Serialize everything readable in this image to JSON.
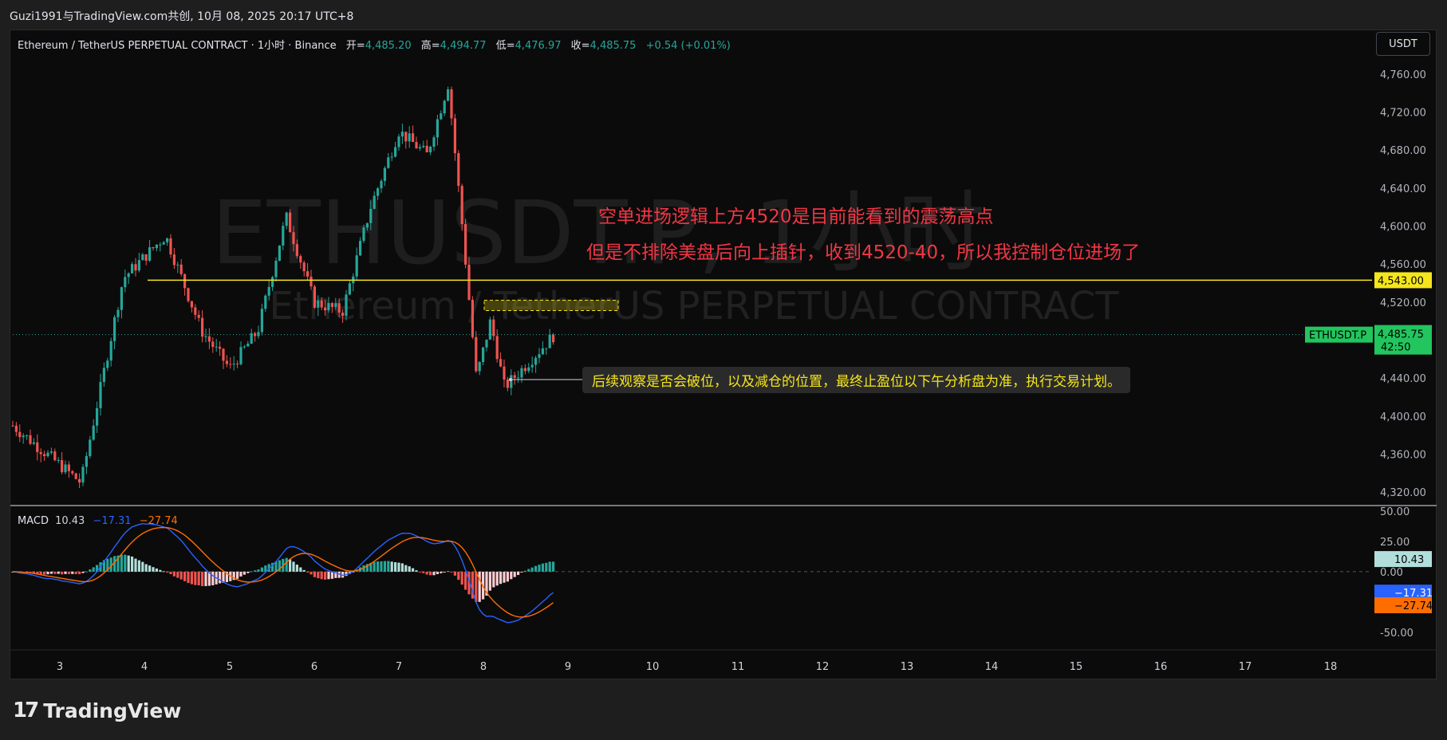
{
  "top_bar": "Guzi1991与TradingView.com共创, 10月 08, 2025 20:17 UTC+8",
  "header": {
    "symbol": "Ethereum / TetherUS PERPETUAL CONTRACT · 1小时 · Binance",
    "open_label": "开=",
    "open": "4,485.20",
    "high_label": "高=",
    "high": "4,494.77",
    "low_label": "低=",
    "low": "4,476.97",
    "close_label": "收=",
    "close": "4,485.75",
    "change": "+0.54 (+0.01%)"
  },
  "currency_button": "USDT",
  "watermark": {
    "line1": "ETHUSDT.P, 1小时",
    "line2": "Ethereum / TetherUS PERPETUAL CONTRACT"
  },
  "annotations": {
    "red_line1": "空单进场逻辑上方4520是目前能看到的震荡高点",
    "red_line2": "但是不排除美盘后向上插针，收到4520-40，所以我控制仓位进场了",
    "callout": "后续观察是否会破位，以及减仓的位置，最终止盈位以下午分析盘为准，执行交易计划。"
  },
  "price_labels": {
    "hline_price": "4,543.00",
    "symbol_tag": "ETHUSDT.P",
    "last_price": "4,485.75",
    "countdown": "42:50"
  },
  "macd_legend": {
    "name": "MACD",
    "hist": "10.43",
    "macd": "−17.31",
    "signal": "−27.74"
  },
  "macd_labels": {
    "hist": "10.43",
    "macd": "−17.31",
    "signal": "−27.74"
  },
  "logo_text": "TradingView",
  "colors": {
    "up": "#26a69a",
    "down": "#ef5350",
    "hline": "#f5e61c",
    "macd": "#2962ff",
    "signal": "#ff6d00",
    "note": "#f23645"
  },
  "chart_data": {
    "type": "candlestick",
    "title": "ETHUSDT.P, 1小时",
    "y_axis_ticks": [
      "4,760.00",
      "4,720.00",
      "4,680.00",
      "4,640.00",
      "4,600.00",
      "4,560.00",
      "4,520.00",
      "4,440.00",
      "4,400.00",
      "4,360.00",
      "4,320.00"
    ],
    "ylim": [
      4305,
      4775
    ],
    "x_axis_ticks": [
      "3",
      "4",
      "5",
      "6",
      "7",
      "8",
      "9",
      "10",
      "11",
      "12",
      "13",
      "14",
      "15",
      "16",
      "17",
      "18"
    ],
    "horizontal_line": 4543,
    "key_points": [
      {
        "date": "3",
        "price": 4390
      },
      {
        "date": "3",
        "price": 4330
      },
      {
        "date": "4",
        "price": 4545
      },
      {
        "date": "4",
        "price": 4590
      },
      {
        "date": "5",
        "price": 4490
      },
      {
        "date": "5",
        "price": 4450
      },
      {
        "date": "5",
        "price": 4490
      },
      {
        "date": "6",
        "price": 4610
      },
      {
        "date": "6",
        "price": 4520
      },
      {
        "date": "6",
        "price": 4510
      },
      {
        "date": "7",
        "price": 4620
      },
      {
        "date": "7",
        "price": 4700
      },
      {
        "date": "7",
        "price": 4675
      },
      {
        "date": "8",
        "price": 4750
      },
      {
        "date": "8",
        "price": 4600
      },
      {
        "date": "8",
        "price": 4440
      },
      {
        "date": "8",
        "price": 4500
      },
      {
        "date": "8",
        "price": 4430
      },
      {
        "date": "8",
        "price": 4485.75
      }
    ],
    "macd_panel": {
      "y_axis_ticks": [
        "50.00",
        "25.00",
        "0.00",
        "-50.00"
      ],
      "ylim": [
        -60,
        52
      ],
      "histogram_last": 10.43,
      "macd_last": -17.31,
      "signal_last": -27.74
    }
  }
}
